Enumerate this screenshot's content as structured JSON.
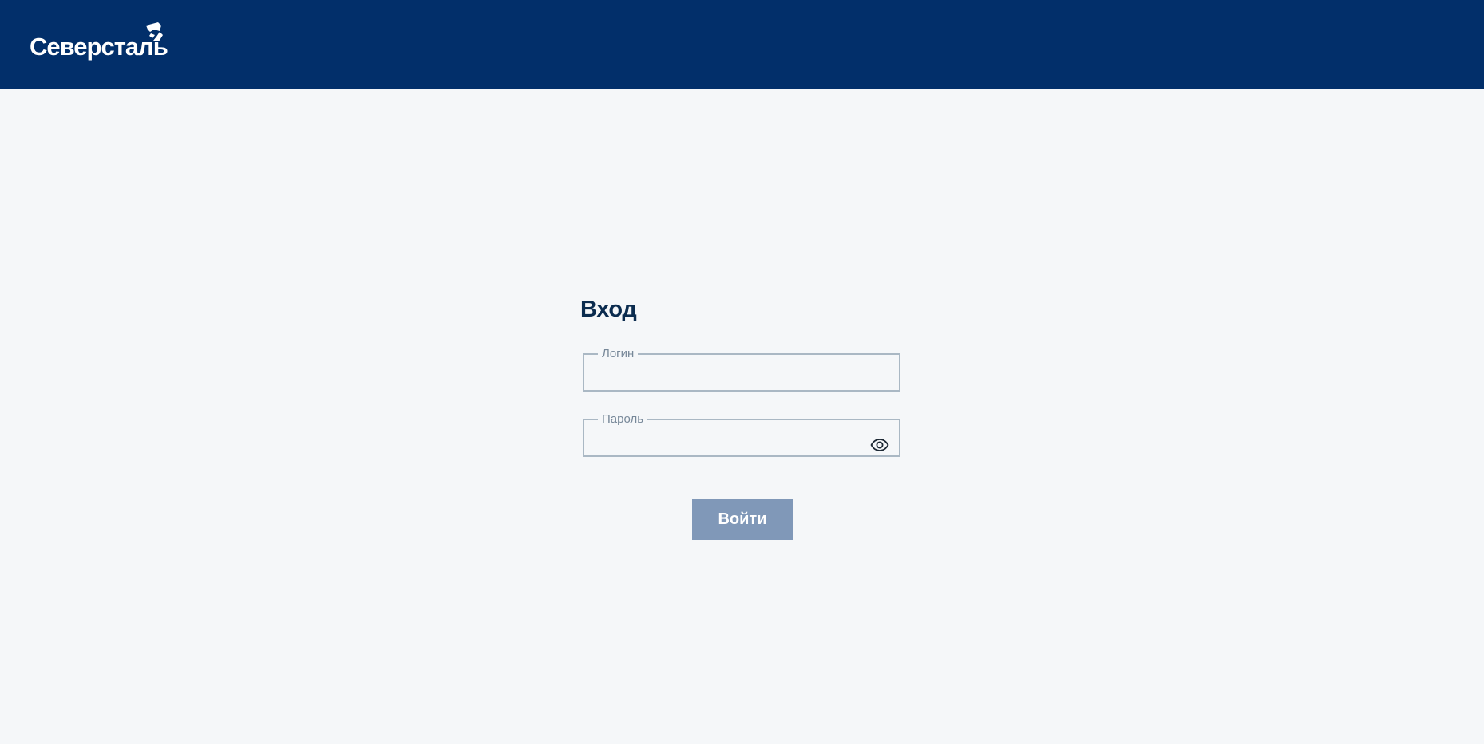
{
  "brand": {
    "name": "Северсталь",
    "header_color": "#022f6a",
    "mark_icon": "severstal-logo-mark"
  },
  "login_form": {
    "title": "Вход",
    "login_label": "Логин",
    "login_value": "",
    "password_label": "Пароль",
    "password_value": "",
    "password_toggle_icon": "eye-icon",
    "submit_label": "Войти",
    "submit_color": "#8098b8",
    "title_color": "#0b2c4f"
  }
}
